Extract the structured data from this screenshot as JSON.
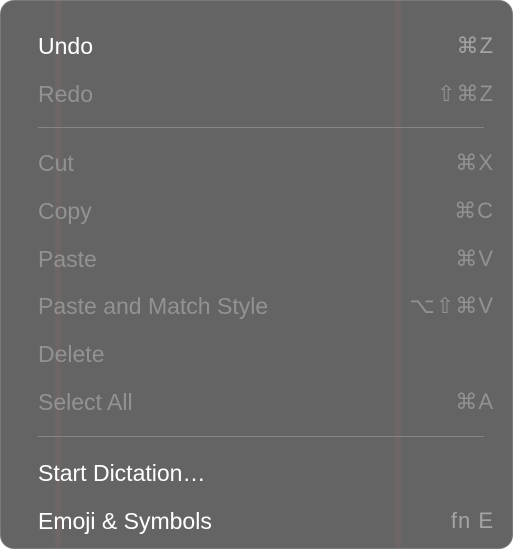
{
  "menu": {
    "items": [
      {
        "label": "Undo",
        "shortcut": "⌘Z"
      },
      {
        "label": "Redo",
        "shortcut": "⇧⌘Z"
      },
      {
        "label": "Cut",
        "shortcut": "⌘X"
      },
      {
        "label": "Copy",
        "shortcut": "⌘C"
      },
      {
        "label": "Paste",
        "shortcut": "⌘V"
      },
      {
        "label": "Paste and Match Style",
        "shortcut": "⌥⇧⌘V"
      },
      {
        "label": "Delete",
        "shortcut": ""
      },
      {
        "label": "Select All",
        "shortcut": "⌘A"
      },
      {
        "label": "Start Dictation…",
        "shortcut": ""
      },
      {
        "label": "Emoji & Symbols",
        "shortcut": "fn E"
      }
    ]
  },
  "colors": {
    "menu_background": "#646464",
    "enabled_text": "#ffffff",
    "disabled_text": "#929292",
    "enabled_shortcut": "#a4a4a4",
    "separator": "#858585"
  }
}
